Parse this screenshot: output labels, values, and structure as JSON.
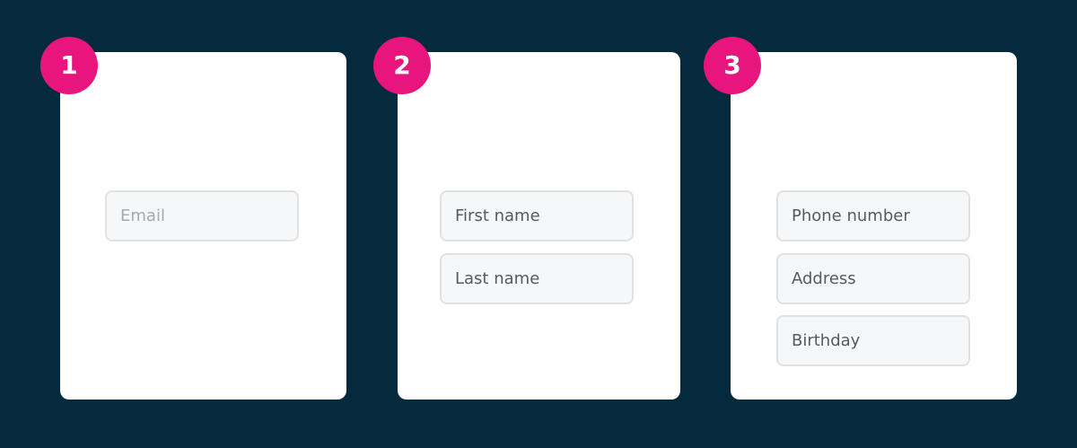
{
  "steps": [
    {
      "number": "1",
      "logo_state": "faded",
      "fields": [
        {
          "label": "Email",
          "state": "placeholder"
        }
      ]
    },
    {
      "number": "2",
      "logo_state": "active",
      "fields": [
        {
          "label": "First name",
          "state": "value"
        },
        {
          "label": "Last name",
          "state": "value"
        }
      ]
    },
    {
      "number": "3",
      "logo_state": "active",
      "fields": [
        {
          "label": "Phone number",
          "state": "value"
        },
        {
          "label": "Address",
          "state": "value"
        },
        {
          "label": "Birthday",
          "state": "value"
        }
      ]
    }
  ],
  "colors": {
    "background": "#062a3d",
    "card": "#ffffff",
    "badge": "#e8157f",
    "field_bg": "#f6f7f8",
    "field_border": "#dfe1e3",
    "logo_gradient_top": "#c410c8",
    "logo_gradient_bottom": "#ff6a2e"
  },
  "icons": {
    "logo": "audio-bars-logo-icon"
  }
}
